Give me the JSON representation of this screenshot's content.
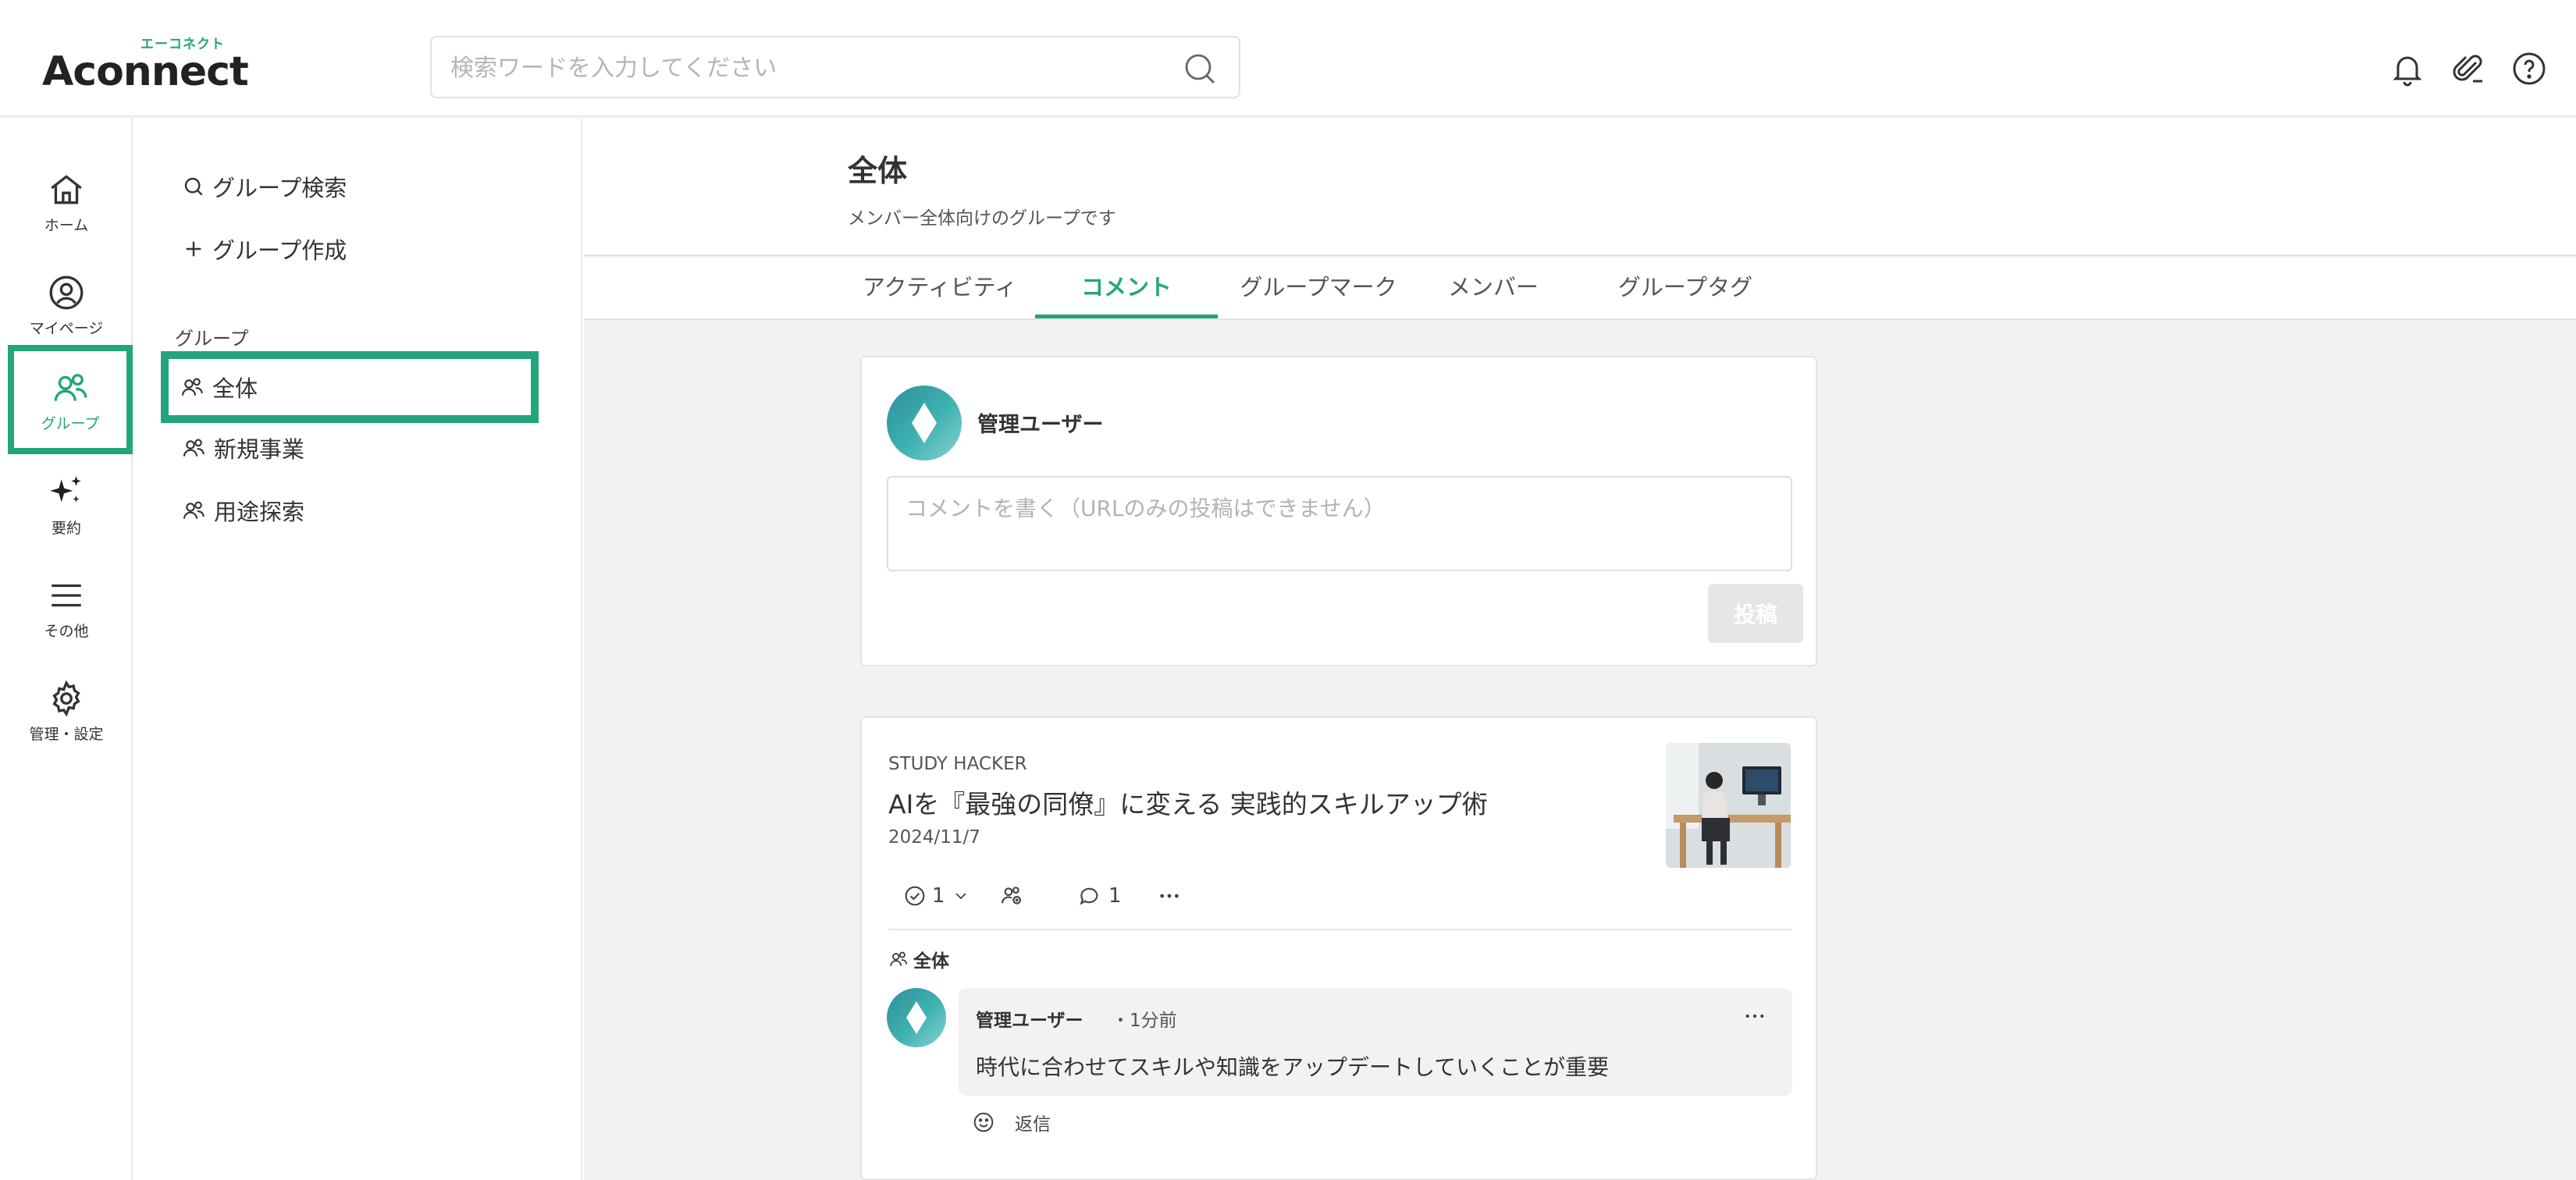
{
  "brand": {
    "name": "Aconnect",
    "kana": "エーコネクト",
    "accent": "#23a57c"
  },
  "search": {
    "placeholder": "検索ワードを入力してください",
    "value": ""
  },
  "header_icons": [
    "bell-icon",
    "paperclip-icon",
    "help-icon"
  ],
  "rail": [
    {
      "id": "home",
      "label": "ホーム",
      "icon": "home-icon",
      "active": false
    },
    {
      "id": "mypage",
      "label": "マイページ",
      "icon": "user-circle-icon",
      "active": false
    },
    {
      "id": "group",
      "label": "グループ",
      "icon": "group-icon",
      "active": true
    },
    {
      "id": "summary",
      "label": "要約",
      "icon": "sparkle-icon",
      "active": false
    },
    {
      "id": "other",
      "label": "その他",
      "icon": "menu-icon",
      "active": false
    },
    {
      "id": "settings",
      "label": "管理・設定",
      "icon": "gear-icon",
      "active": false
    }
  ],
  "group_sidebar": {
    "search_label": "グループ検索",
    "create_label": "グループ作成",
    "section_title": "グループ",
    "items": [
      {
        "label": "全体",
        "active": true
      },
      {
        "label": "新規事業",
        "active": false
      },
      {
        "label": "用途探索",
        "active": false
      }
    ]
  },
  "group": {
    "title": "全体",
    "description": "メンバー全体向けのグループです"
  },
  "tabs": [
    {
      "label": "アクティビティ",
      "active": false
    },
    {
      "label": "コメント",
      "active": true
    },
    {
      "label": "グループマーク",
      "active": false
    },
    {
      "label": "メンバー",
      "active": false
    },
    {
      "label": "グループタグ",
      "active": false
    }
  ],
  "composer": {
    "user_name": "管理ユーザー",
    "placeholder": "コメントを書く（URLのみの投稿はできません）",
    "post_label": "投稿"
  },
  "post": {
    "source": "STUDY HACKER",
    "title": "AIを『最強の同僚』に変える 実践的スキルアップ術",
    "date": "2024/11/7",
    "check_count": "1",
    "comment_count": "1",
    "group_tag": "全体",
    "comment": {
      "user_name": "管理ユーザー",
      "time": "・1分前",
      "text": "時代に合わせてスキルや知識をアップデートしていくことが重要",
      "reply_label": "返信"
    }
  }
}
